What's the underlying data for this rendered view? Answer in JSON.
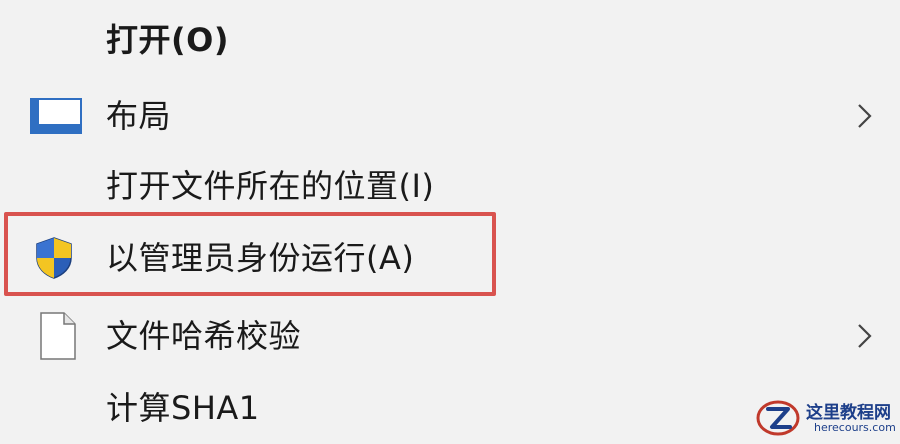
{
  "menu": {
    "items": [
      {
        "label": "打开(O)",
        "bold": true,
        "icon": "none",
        "submenu": false
      },
      {
        "label": "布局",
        "bold": false,
        "icon": "layout-window-icon",
        "submenu": true
      },
      {
        "label": "打开文件所在的位置(I)",
        "bold": false,
        "icon": "none",
        "submenu": false
      },
      {
        "label": "以管理员身份运行(A)",
        "bold": false,
        "icon": "uac-shield-icon",
        "submenu": false,
        "highlighted": true
      },
      {
        "label": "文件哈希校验",
        "bold": false,
        "icon": "file-icon",
        "submenu": true
      },
      {
        "label": "计算SHA1",
        "bold": false,
        "icon": "none",
        "submenu": false
      }
    ],
    "highlight_color": "#d9534f"
  },
  "watermark": {
    "title": "这里教程网",
    "url": "herecours.com"
  }
}
